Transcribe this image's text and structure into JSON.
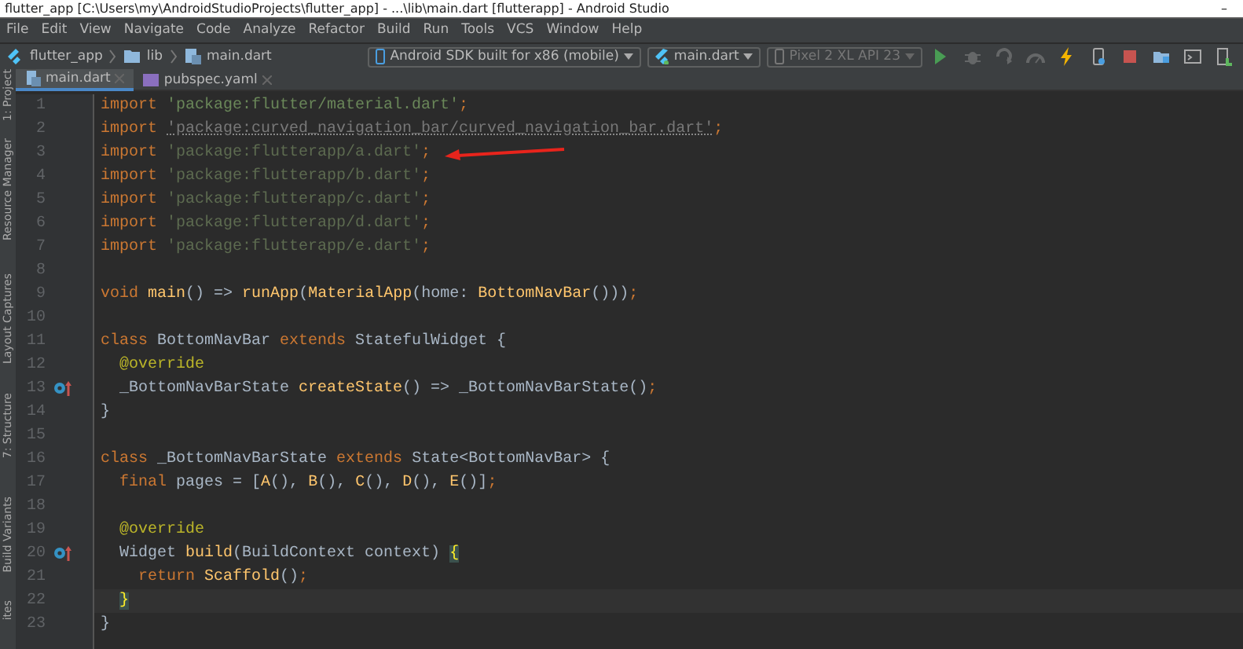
{
  "window": {
    "title": "flutter_app [C:\\Users\\my\\AndroidStudioProjects\\flutter_app] - ...\\lib\\main.dart [flutterapp] - Android Studio",
    "minimize": "–"
  },
  "menu": [
    "File",
    "Edit",
    "View",
    "Navigate",
    "Code",
    "Analyze",
    "Refactor",
    "Build",
    "Run",
    "Tools",
    "VCS",
    "Window",
    "Help"
  ],
  "breadcrumbs": [
    {
      "label": "flutter_app",
      "kind": "project"
    },
    {
      "label": "lib",
      "kind": "folder"
    },
    {
      "label": "main.dart",
      "kind": "file"
    }
  ],
  "toolbar": {
    "device_target": "Android SDK built for x86 (mobile)",
    "run_config": "main.dart",
    "emulator": {
      "label": "Pixel 2 XL API 23",
      "disabled": true
    },
    "actions": [
      {
        "kind": "run",
        "disabled": false
      },
      {
        "kind": "debug",
        "disabled": true
      },
      {
        "kind": "attach",
        "disabled": true
      },
      {
        "kind": "profile",
        "disabled": true
      },
      {
        "kind": "reload",
        "disabled": false
      },
      {
        "kind": "device",
        "disabled": false
      },
      {
        "kind": "stop",
        "disabled": false
      },
      {
        "kind": "structure",
        "disabled": false
      },
      {
        "kind": "terminal",
        "disabled": false
      },
      {
        "kind": "sdk",
        "disabled": false
      }
    ]
  },
  "side_tools": [
    "1: Project",
    "Resource Manager",
    "Layout Captures",
    "7: Structure",
    "Build Variants",
    "ites"
  ],
  "tabs": [
    {
      "label": "main.dart",
      "selected": true,
      "kind": "dart"
    },
    {
      "label": "pubspec.yaml",
      "selected": false,
      "kind": "yaml"
    }
  ],
  "editor": {
    "lines": [
      {
        "number": "1",
        "tokens": [
          {
            "text": "import ",
            "kind": "keyword"
          },
          {
            "text": "'package:flutter/material.dart'",
            "kind": "string"
          },
          {
            "text": ";",
            "kind": "keyword"
          }
        ]
      },
      {
        "number": "2",
        "tokens": [
          {
            "text": "import ",
            "kind": "keyword"
          },
          {
            "text": "'package:curved_navigation_bar/curved_navigation_bar.dart'",
            "kind": "unused"
          },
          {
            "text": ";",
            "kind": "keyword"
          }
        ]
      },
      {
        "number": "3",
        "tokens": [
          {
            "text": "import ",
            "kind": "keyword"
          },
          {
            "text": "'package:flutterapp/a.dart'",
            "kind": "dimstring"
          },
          {
            "text": ";",
            "kind": "keyword"
          }
        ]
      },
      {
        "number": "4",
        "tokens": [
          {
            "text": "import ",
            "kind": "keyword"
          },
          {
            "text": "'package:flutterapp/b.dart'",
            "kind": "dimstring"
          },
          {
            "text": ";",
            "kind": "keyword"
          }
        ]
      },
      {
        "number": "5",
        "tokens": [
          {
            "text": "import ",
            "kind": "keyword"
          },
          {
            "text": "'package:flutterapp/c.dart'",
            "kind": "dimstring"
          },
          {
            "text": ";",
            "kind": "keyword"
          }
        ]
      },
      {
        "number": "6",
        "tokens": [
          {
            "text": "import ",
            "kind": "keyword"
          },
          {
            "text": "'package:flutterapp/d.dart'",
            "kind": "dimstring"
          },
          {
            "text": ";",
            "kind": "keyword"
          }
        ]
      },
      {
        "number": "7",
        "tokens": [
          {
            "text": "import ",
            "kind": "keyword"
          },
          {
            "text": "'package:flutterapp/e.dart'",
            "kind": "dimstring"
          },
          {
            "text": ";",
            "kind": "keyword"
          }
        ]
      },
      {
        "number": "8"
      },
      {
        "number": "9",
        "tokens": [
          {
            "text": "void ",
            "kind": "keyword"
          },
          {
            "text": "main",
            "kind": "function"
          },
          {
            "text": "() => ",
            "kind": "plain"
          },
          {
            "text": "runApp",
            "kind": "function"
          },
          {
            "text": "(",
            "kind": "plain"
          },
          {
            "text": "MaterialApp",
            "kind": "function"
          },
          {
            "text": "(home: ",
            "kind": "plain"
          },
          {
            "text": "BottomNavBar",
            "kind": "function"
          },
          {
            "text": "()))",
            "kind": "plain"
          },
          {
            "text": ";",
            "kind": "keyword"
          }
        ]
      },
      {
        "number": "10"
      },
      {
        "number": "11",
        "tokens": [
          {
            "text": "class ",
            "kind": "keyword"
          },
          {
            "text": "BottomNavBar ",
            "kind": "plain"
          },
          {
            "text": "extends ",
            "kind": "keyword"
          },
          {
            "text": "StatefulWidget {",
            "kind": "plain"
          }
        ]
      },
      {
        "number": "12",
        "tokens": [
          {
            "text": "  @override",
            "kind": "annotation"
          }
        ]
      },
      {
        "number": "13",
        "overrides": true,
        "tokens": [
          {
            "text": "  _BottomNavBarState ",
            "kind": "plain"
          },
          {
            "text": "createState",
            "kind": "function"
          },
          {
            "text": "() => _BottomNavBarState()",
            "kind": "plain"
          },
          {
            "text": ";",
            "kind": "keyword"
          }
        ]
      },
      {
        "number": "14",
        "tokens": [
          {
            "text": "}",
            "kind": "plain"
          }
        ]
      },
      {
        "number": "15"
      },
      {
        "number": "16",
        "tokens": [
          {
            "text": "class ",
            "kind": "keyword"
          },
          {
            "text": "_BottomNavBarState ",
            "kind": "plain"
          },
          {
            "text": "extends ",
            "kind": "keyword"
          },
          {
            "text": "State<BottomNavBar> {",
            "kind": "plain"
          }
        ]
      },
      {
        "number": "17",
        "tokens": [
          {
            "text": "  final ",
            "kind": "keyword"
          },
          {
            "text": "pages = [",
            "kind": "plain"
          },
          {
            "text": "A",
            "kind": "function"
          },
          {
            "text": "(), ",
            "kind": "plain"
          },
          {
            "text": "B",
            "kind": "function"
          },
          {
            "text": "(), ",
            "kind": "plain"
          },
          {
            "text": "C",
            "kind": "function"
          },
          {
            "text": "(), ",
            "kind": "plain"
          },
          {
            "text": "D",
            "kind": "function"
          },
          {
            "text": "(), ",
            "kind": "plain"
          },
          {
            "text": "E",
            "kind": "function"
          },
          {
            "text": "()]",
            "kind": "plain"
          },
          {
            "text": ";",
            "kind": "keyword"
          }
        ]
      },
      {
        "number": "18"
      },
      {
        "number": "19",
        "tokens": [
          {
            "text": "  @override",
            "kind": "annotation"
          }
        ]
      },
      {
        "number": "20",
        "overrides": true,
        "tokens": [
          {
            "text": "  Widget ",
            "kind": "plain"
          },
          {
            "text": "build",
            "kind": "function"
          },
          {
            "text": "(BuildContext context) ",
            "kind": "plain"
          },
          {
            "text": "{",
            "kind": "match"
          }
        ]
      },
      {
        "number": "21",
        "tokens": [
          {
            "text": "    return ",
            "kind": "keyword"
          },
          {
            "text": "Scaffold",
            "kind": "function"
          },
          {
            "text": "()",
            "kind": "plain"
          },
          {
            "text": ";",
            "kind": "keyword"
          }
        ]
      },
      {
        "number": "22",
        "current": true,
        "tokens": [
          {
            "text": "  }",
            "kind": "match"
          }
        ]
      },
      {
        "number": "23",
        "tokens": [
          {
            "text": "}",
            "kind": "plain"
          }
        ]
      }
    ]
  }
}
